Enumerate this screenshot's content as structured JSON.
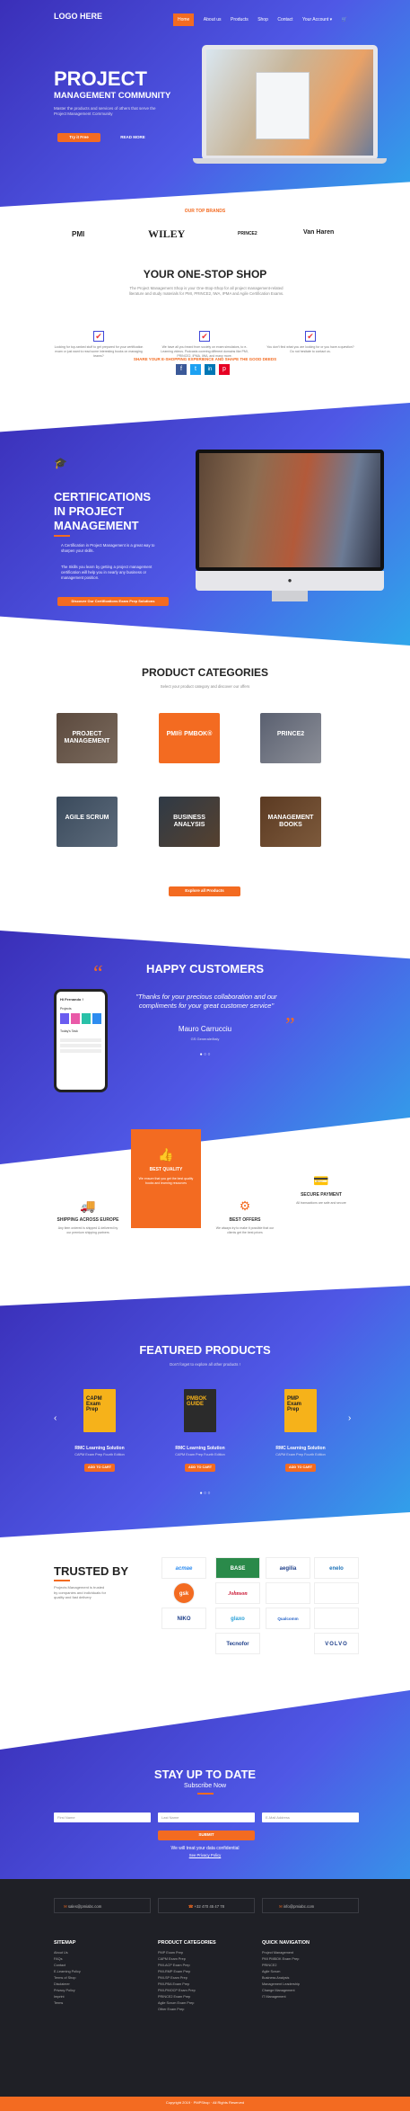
{
  "nav": {
    "logo": "LOGO HERE",
    "links": [
      "Home",
      "About us",
      "Products",
      "Shop",
      "Contact",
      "Your Account ▾"
    ],
    "cart_count": "0"
  },
  "hero": {
    "title": "PROJECT",
    "subtitle": "MANAGEMENT COMMUNITY",
    "desc": "Master the products and services of others that serve the Project Management Community",
    "btn_primary": "Try it Free",
    "btn_secondary": "READ MORE"
  },
  "brands": {
    "heading": "OUR TOP BRANDS",
    "items": [
      "PMI",
      "WILEY",
      "PRINCE2",
      "Van Haren"
    ]
  },
  "shop": {
    "title": "YOUR ONE-STOP SHOP",
    "desc": "The Project Management Shop is your One-Stop-Shop for all project management-related literature and study materials for PMI, PRINCE2, IWA, IPMA and Agile Certification Exams.",
    "features": [
      "Looking for top-ranked stuff to get prepared for your certification exam or just want to read some interesting books on managing teams?",
      "We have all you heard from society on exam simulators, to e-Learning videos. Podcasts covering different domains like PMI, PRINCE2, IPMA, IWA, and many more.",
      "You don't find what you are looking for or you have a question? Do not hesitate to contact us."
    ],
    "share_text": "SHARE YOUR E-SHOPPING EXPERIENCE AND SHAPE THE GOOD DEEDS"
  },
  "cert": {
    "title1": "CERTIFICATIONS",
    "title2": "IN PROJECT",
    "title3": "MANAGEMENT",
    "bullets": [
      "A Certification in Project Management is a great way to sharpen your skills.",
      "The Skills you learn by getting a project management certification will help you in nearly any business or management position."
    ],
    "btn": "Discover Our Certifications Exam Prep Solutions"
  },
  "categories": {
    "title": "PRODUCT CATEGORIES",
    "desc": "Select your product category and discover our offers",
    "items": [
      "PROJECT MANAGEMENT",
      "PMI® PMBOK®",
      "PRINCE2",
      "AGILE SCRUM",
      "BUSINESS ANALYSIS",
      "MANAGEMENT BOOKS"
    ],
    "btn": "Explore all Products"
  },
  "customers": {
    "title": "HAPPY CUSTOMERS",
    "quote": "\"Thanks for your precious collaboration and our compliments for your great customer service\"",
    "author": "Mauro Carrucciu",
    "role": "GS Generale/Italy",
    "phone_greeting": "Hi Fernando !",
    "phone_label": "Projects",
    "phone_tasks": "Today's Task"
  },
  "features": [
    {
      "title": "SHIPPING ACROSS EUROPE",
      "desc": "Any item ordered is shipped & delivered by our premium shipping partners"
    },
    {
      "title": "BEST QUALITY",
      "desc": "We ensure that you get the best quality books and learning resources"
    },
    {
      "title": "BEST OFFERS",
      "desc": "We always try to make it possible that our clients get the best prices"
    },
    {
      "title": "SECURE PAYMENT",
      "desc": "All transactions are safe and secure"
    }
  ],
  "featured": {
    "title": "FEATURED PRODUCTS",
    "desc": "Don't forget to explore all other products !",
    "products": [
      {
        "cover": "CAPM Exam Prep",
        "name": "RMC Learning Solution",
        "sub": "CAPM Exam Prep Fourth Edition",
        "btn": "ADD TO CART"
      },
      {
        "cover": "PMBOK GUIDE",
        "name": "RMC Learning Solution",
        "sub": "CAPM Exam Prep Fourth Edition",
        "btn": "ADD TO CART"
      },
      {
        "cover": "PMP Exam Prep",
        "name": "RMC Learning Solution",
        "sub": "CAPM Exam Prep Fourth Edition",
        "btn": "ADD TO CART"
      }
    ]
  },
  "trusted": {
    "title": "TRUSTED BY",
    "desc": "Projects Management is trusted by companies and individuals for quality and fast delivery",
    "logos": [
      "acmae",
      "BASE",
      "aegilia",
      "enelo",
      "gsk",
      "Johnson",
      "",
      "",
      "NIKO",
      "glaxo",
      "Qualcomm",
      "",
      "Tecnofor",
      "VOLVO"
    ]
  },
  "subscribe": {
    "title": "STAY UP TO DATE",
    "subtitle": "Subscribe Now",
    "first": "First Name",
    "last": "Last Name",
    "email": "E-Mail Address",
    "btn": "SUBMIT",
    "note": "We will treat your data confidential",
    "privacy": "See Privacy Policy"
  },
  "footer": {
    "email": "sales@pmiabc.com",
    "phone": "+32 470 45 47 78",
    "email2": "info@pmiabc.com",
    "sitemap_title": "SITEMAP",
    "sitemap": [
      "About Us",
      "FAQs",
      "Contact",
      "E-Learning Policy",
      "Terms of Shop",
      "Disclaimer",
      "Privacy Policy",
      "Imprint",
      "Terms"
    ],
    "cat_title": "PRODUCT CATEGORIES",
    "cats": [
      "PMP Exam Prep",
      "CAPM Exam Prep",
      "PMI-ACP Exam Prep",
      "PMI-RMP Exam Prep",
      "PMI-SP Exam Prep",
      "PMI-PBA Exam Prep",
      "PMI-PMOCP Exam Prep",
      "PRINCE2 Exam Prep",
      "Agile Scrum Exam Prep",
      "Other Exam Prep"
    ],
    "nav_title": "QUICK NAVIGATION",
    "navs": [
      "Project Management",
      "PMI PMBOK Exam Prep",
      "PRINCE2",
      "Agile Scrum",
      "Business Analysis",
      "Management Leadership",
      "Change Management",
      "IT Management"
    ],
    "copyright": "Copyright 2019 · PMPShop · All Rights Reserved"
  },
  "colors": {
    "accent": "#f36b21",
    "primary": "#4047d8",
    "dark": "#1f2026"
  }
}
